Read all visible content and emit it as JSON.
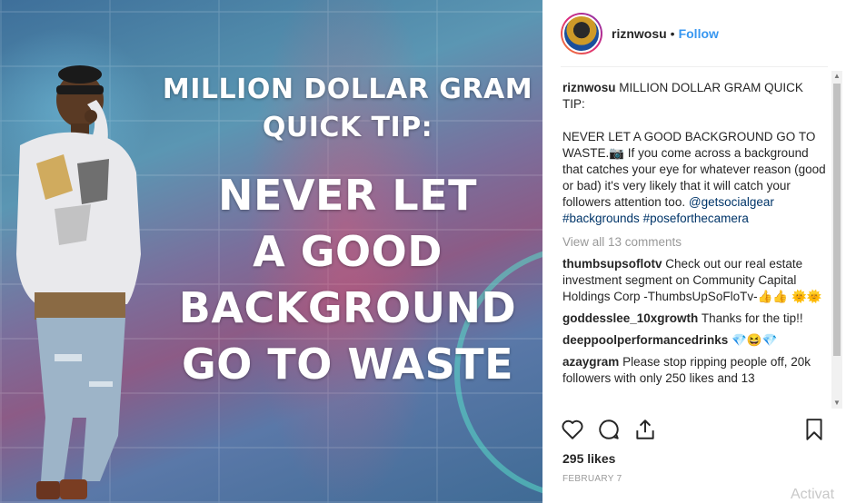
{
  "post": {
    "headline_line1": "MILLION DOLLAR GRAM",
    "headline_line2": "QUICK TIP:",
    "headline_line3": "NEVER LET",
    "headline_line4": "A GOOD",
    "headline_line5": "BACKGROUND",
    "headline_line6": "GO TO WASTE"
  },
  "header": {
    "username": "riznwosu",
    "separator": "•",
    "follow_label": "Follow"
  },
  "caption": {
    "username": "riznwosu",
    "text1": "MILLION DOLLAR GRAM QUICK TIP:",
    "text2": "NEVER LET A GOOD BACKGROUND GO TO WASTE.📷 If you come across a background that catches your eye for whatever reason (good or bad) it's very likely that it will catch your followers attention too.",
    "mention": "@getsocialgear",
    "hashtag1": "#backgrounds",
    "hashtag2": "#poseforthecamera"
  },
  "view_all": "View all 13 comments",
  "comments": [
    {
      "user": "thumbsupsoflotv",
      "text": "Check out our real estate investment segment on Community Capital Holdings Corp -ThumbsUpSoFloTv-👍👍 🌞🌞"
    },
    {
      "user": "goddesslee_10xgrowth",
      "text": "Thanks for the tip!!"
    },
    {
      "user": "deeppoolperformancedrinks",
      "text": "💎😆💎"
    },
    {
      "user": "azaygram",
      "text": "Please stop ripping people off, 20k followers with only 250 likes and 13"
    }
  ],
  "icons": {
    "like": "heart-icon",
    "comment": "comment-icon",
    "share": "share-icon",
    "save": "bookmark-icon"
  },
  "likes": "295 likes",
  "date": "FEBRUARY 7",
  "watermark": "Activat"
}
